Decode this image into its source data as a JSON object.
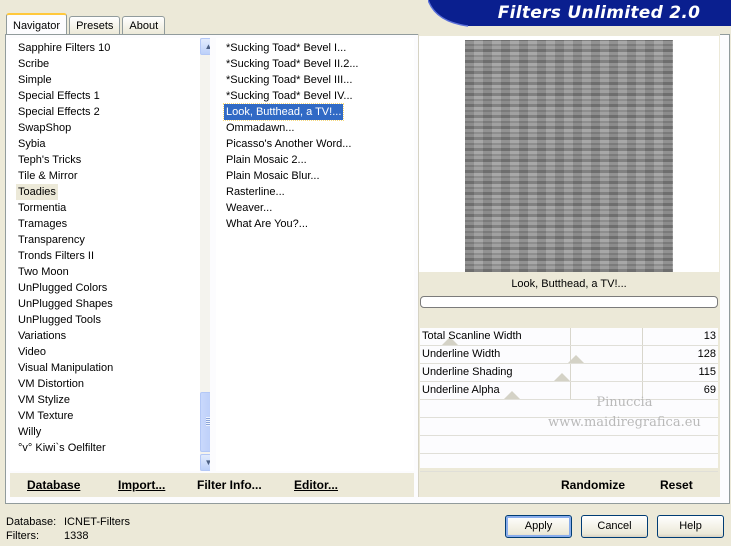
{
  "tabs": {
    "navigator": "Navigator",
    "presets": "Presets",
    "about": "About"
  },
  "header": {
    "title": "Filters Unlimited 2.0"
  },
  "categories": [
    "Sapphire Filters 10",
    "Scribe",
    "Simple",
    "Special Effects 1",
    "Special Effects 2",
    "SwapShop",
    "Sybia",
    "Teph's Tricks",
    "Tile & Mirror",
    "Toadies",
    "Tormentia",
    "Tramages",
    "Transparency",
    "Tronds Filters II",
    "Two Moon",
    "UnPlugged Colors",
    "UnPlugged Shapes",
    "UnPlugged Tools",
    "Variations",
    "Video",
    "Visual Manipulation",
    "VM Distortion",
    "VM Stylize",
    "VM Texture",
    "Willy",
    "°v° Kiwi`s Oelfilter"
  ],
  "selected_category": "Toadies",
  "filters": [
    "*Sucking Toad*  Bevel I...",
    "*Sucking Toad*  Bevel II.2...",
    "*Sucking Toad*  Bevel III...",
    "*Sucking Toad*  Bevel IV...",
    "Look, Butthead, a TV!...",
    "Ommadawn...",
    "Picasso's Another Word...",
    "Plain Mosaic 2...",
    "Plain Mosaic Blur...",
    "Rasterline...",
    "Weaver...",
    "What Are You?..."
  ],
  "selected_filter": "Look, Butthead, a TV!...",
  "preview": {
    "filter_name": "Look, Butthead, a TV!...",
    "progress": 0
  },
  "params": [
    {
      "label": "Total Scanline Width",
      "value": "13",
      "level": 0.05
    },
    {
      "label": "Underline Width",
      "value": "128",
      "level": 0.5
    },
    {
      "label": "Underline Shading",
      "value": "115",
      "level": 0.45
    },
    {
      "label": "Underline Alpha",
      "value": "69",
      "level": 0.27
    }
  ],
  "watermark": {
    "line1": "Pinuccia",
    "line2": "www.maidiregrafica.eu"
  },
  "bottom_buttons": {
    "database": "Database",
    "import": "Import...",
    "filter_info": "Filter Info...",
    "editor": "Editor...",
    "randomize": "Randomize",
    "reset": "Reset"
  },
  "status": {
    "database_label": "Database:",
    "database_value": "ICNET-Filters",
    "filters_label": "Filters:",
    "filters_value": "1338"
  },
  "dialog_buttons": {
    "apply": "Apply",
    "cancel": "Cancel",
    "help": "Help"
  },
  "colors": {
    "selection": "#316ac5",
    "banner": "#0a1f8f",
    "window": "#ece9d8"
  }
}
